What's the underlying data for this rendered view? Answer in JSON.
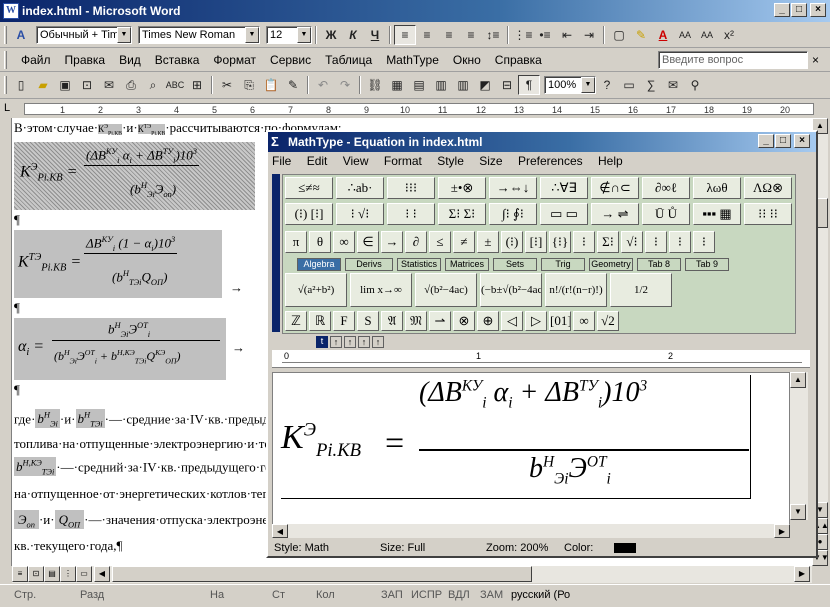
{
  "window": {
    "title": "index.html - Microsoft Word"
  },
  "format_toolbar": {
    "style": "Обычный + Time",
    "font": "Times New Roman",
    "size": "12",
    "bold": "Ж",
    "italic": "К",
    "underline": "Ч"
  },
  "menu": [
    "Файл",
    "Правка",
    "Вид",
    "Вставка",
    "Формат",
    "Сервис",
    "Таблица",
    "MathType",
    "Окно",
    "Справка"
  ],
  "help_box": {
    "placeholder": "Введите вопрос"
  },
  "standard_toolbar": {
    "zoom": "100%",
    "pilcrow": "¶"
  },
  "ruler_numbers": [
    "1",
    "2",
    "3",
    "4",
    "5",
    "6",
    "7",
    "8",
    "9",
    "10",
    "11",
    "12",
    "13",
    "14",
    "15",
    "16",
    "17",
    "18",
    "19",
    "20"
  ],
  "document": {
    "line1": "В·этом·случае·",
    "line1b": "·и·",
    "line1c": "·рассчитываются·по·формулам:",
    "para": "¶",
    "arrow": "→",
    "line_where_a": "где·",
    "line_where_b": "·и·",
    "line_where_c": "·—·средние·за·IV·кв.·предыдущего·года·удельные·расходы·",
    "line_fuel": "топлива·на·отпущенные·электроэнергию·и·тепло;¶",
    "line_avg": "·—·средний·за·IV·кв.·предыдущего·года·удельный·расход·топлива",
    "line_released": "на·отпущенное·от·энергетических·котлов·тепло;¶",
    "line_and": "·и·",
    "line_values": "·—·значения·отпуска·электроэнергии·и·тепла·в·IV",
    "line_quarter": "кв.·текущего·года,¶"
  },
  "status": {
    "page": "Стр.",
    "section": "Разд",
    "at": "На",
    "line": "Ст",
    "col": "Кол",
    "rec": "ЗАП",
    "trk": "ИСПР",
    "ext": "ВДЛ",
    "ovr": "ЗАМ",
    "lang": "русский (Ро"
  },
  "mathtype": {
    "title": "MathType - Equation in index.html",
    "menu": [
      "File",
      "Edit",
      "View",
      "Format",
      "Style",
      "Size",
      "Preferences",
      "Help"
    ],
    "row1": [
      "≤≠≈",
      "∴ab·",
      "⁝⁝⁝",
      "±•⊗",
      "→⇔↓",
      "∴∀∃",
      "∉∩⊂",
      "∂∞ℓ",
      "λωθ",
      "ΛΩ⊗"
    ],
    "row2": [
      "(⁝) [⁝]",
      "⁝ √⁝",
      "⁝ ⁝",
      "Σ⁝ Σ⁝",
      "∫⁝ ∮⁝",
      "▭ ▭",
      "→ ⇌",
      "Ū Ů",
      "▪▪▪ ▦",
      "⁝⁝ ⁝⁝"
    ],
    "row3": [
      "π",
      "θ",
      "∞",
      "∈",
      "→",
      "∂",
      "≤",
      "≠",
      "±",
      "(⁝)",
      "[⁝]",
      "{⁝}",
      "⁝",
      "Σ⁝",
      "√⁝",
      "⁝",
      "⁝",
      "⁝"
    ],
    "tabs": [
      "Algebra",
      "Derivs",
      "Statistics",
      "Matrices",
      "Sets",
      "Trig",
      "Geometry",
      "Tab 8",
      "Tab 9"
    ],
    "tab_templates": [
      "√(a²+b²)",
      "lim x→∞",
      "√(b²−4ac)",
      "(−b±√(b²−4ac))/2a",
      "n!/(r!(n−r)!)",
      "1/2"
    ],
    "row5": [
      "ℤ",
      "ℝ",
      "F",
      "S",
      "𝔄",
      "𝔐",
      "⇀",
      "⊗",
      "⊕",
      "◁",
      "▷",
      "[01]",
      "∞",
      "√2"
    ],
    "ruler_labels": [
      "0",
      "1",
      "2"
    ],
    "status": {
      "style": "Style: Math",
      "size": "Size: Full",
      "zoom": "Zoom: 200%",
      "color": "Color:"
    }
  }
}
